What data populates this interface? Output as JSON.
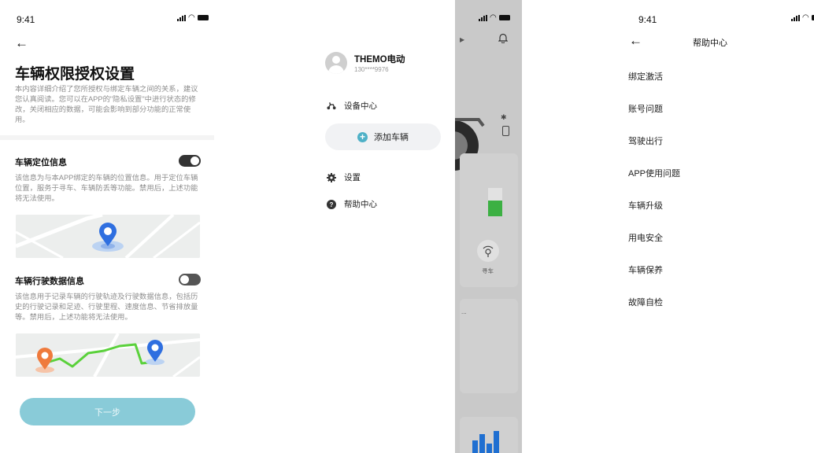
{
  "screen1": {
    "status_time": "9:41",
    "title": "车辆权限授权设置",
    "intro": "本内容详细介绍了您所授权与绑定车辆之间的关系，建议您认真阅读。您可以在APP的\"隐私设置\"中进行状态的修改，关闭相应的数据，可能会影响到部分功能的正常使用。",
    "location": {
      "title": "车辆定位信息",
      "enabled": true,
      "desc": "该信息为与本APP绑定的车辆的位置信息。用于定位车辆位置，服务于寻车、车辆防丢等功能。禁用后，上述功能将无法使用。"
    },
    "driving": {
      "title": "车辆行驶数据信息",
      "enabled": false,
      "desc": "该信息用于记录车辆的行驶轨迹及行驶数据信息，包括历史的行驶记录和足迹、行驶里程、速度信息、节省排放量等。禁用后，上述功能将无法使用。"
    },
    "next_button": "下一步",
    "colors": {
      "accent": "#89cbd8",
      "pin_blue": "#2f6fe0",
      "pin_orange": "#ef7a3c",
      "route_green": "#5ad13b"
    }
  },
  "screen2": {
    "user_name": "THEMO电动",
    "user_phone": "130****9976",
    "menu": [
      {
        "label": "设备中心",
        "icon": "scooter-icon"
      },
      {
        "label": "设置",
        "icon": "gear-icon"
      },
      {
        "label": "帮助中心",
        "icon": "help-icon"
      }
    ],
    "add_vehicle": "添加车辆",
    "background": {
      "find_car": "寻车",
      "ellipsis": "..."
    },
    "colors": {
      "accent": "#4fb1c7",
      "bar_green": "#3cb043",
      "chart_blue": "#1f6fd1"
    }
  },
  "screen3": {
    "status_time": "9:41",
    "title": "帮助中心",
    "items": [
      "绑定激活",
      "账号问题",
      "驾驶出行",
      "APP使用问题",
      "车辆升级",
      "用电安全",
      "车辆保养",
      "故障自检"
    ]
  }
}
